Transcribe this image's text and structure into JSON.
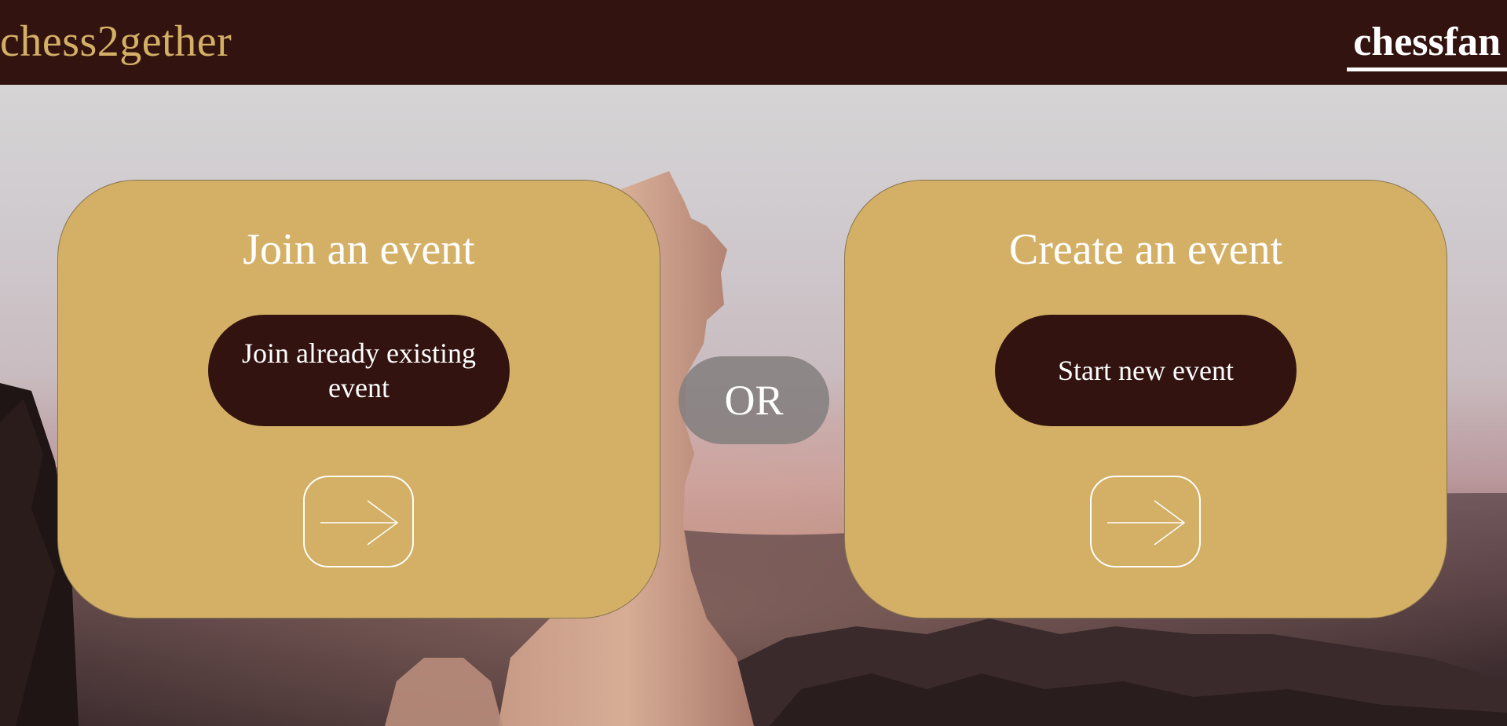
{
  "header": {
    "logo": "chess2gether",
    "user": "chessfan"
  },
  "join_card": {
    "title": "Join an event",
    "button_label": "Join already existing event",
    "arrow_icon": "arrow-right-icon"
  },
  "divider": {
    "label": "OR"
  },
  "create_card": {
    "title": "Create an event",
    "button_label": "Start new event",
    "arrow_icon": "arrow-right-icon"
  },
  "colors": {
    "header_bg": "#33130f",
    "logo": "#d3b065",
    "card_bg": "#d3b065",
    "button_bg": "#33130f",
    "text_light": "#ffffff"
  }
}
